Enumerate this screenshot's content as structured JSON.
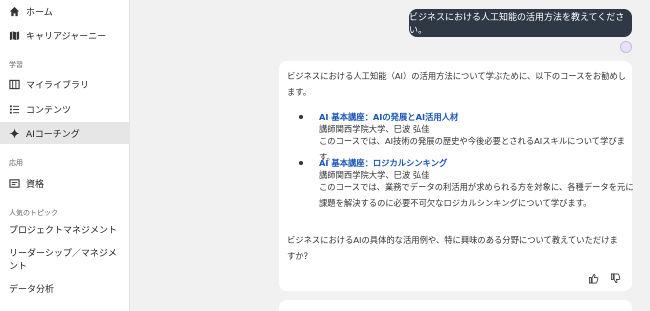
{
  "sidebar": {
    "nav": [
      {
        "label": "ホーム",
        "icon": "home-icon"
      },
      {
        "label": "キャリアジャーニー",
        "icon": "map-icon"
      }
    ],
    "section_learning": "学習",
    "learning": [
      {
        "label": "マイライブラリ",
        "icon": "library-icon"
      },
      {
        "label": "コンテンツ",
        "icon": "list-icon"
      },
      {
        "label": "AIコーチング",
        "icon": "sparkle-icon"
      }
    ],
    "section_apply": "応用",
    "apply": [
      {
        "label": "資格",
        "icon": "certificate-icon"
      }
    ],
    "section_topics": "人気のトピック",
    "topics": [
      "プロジェクトマネジメント",
      "リーダーシップ／マネジメント",
      "データ分析"
    ]
  },
  "chat": {
    "user_message": "ビジネスにおける人工知能の活用方法を教えてください。",
    "reply": {
      "intro": "ビジネスにおける人工知能（AI）の活用方法について学ぶために、以下のコースをお勧めします。",
      "courses": [
        {
          "title": "AI 基本講座：AIの発展とAI活用人材",
          "instructor": "講師関西学院大学、巳波 弘佳",
          "description": "このコースでは、AI技術の発展の歴史や今後必要とされるAIスキルについて学びます。"
        },
        {
          "title": "AI 基本講座：ロジカルシンキング",
          "instructor": "講師関西学院大学、巳波 弘佳",
          "description": "このコースでは、業務でデータの利活用が求められる方を対象に、各種データを元に課題を解決するのに必要不可欠なロジカルシンキングについて学びます。"
        }
      ],
      "closing": "ビジネスにおけるAIの具体的な活用例や、特に興味のある分野について教えていただけますか？"
    }
  },
  "colors": {
    "link": "#1a56b8",
    "user_bubble": "#2f3946",
    "sidebar_active": "#e6e6e6"
  }
}
